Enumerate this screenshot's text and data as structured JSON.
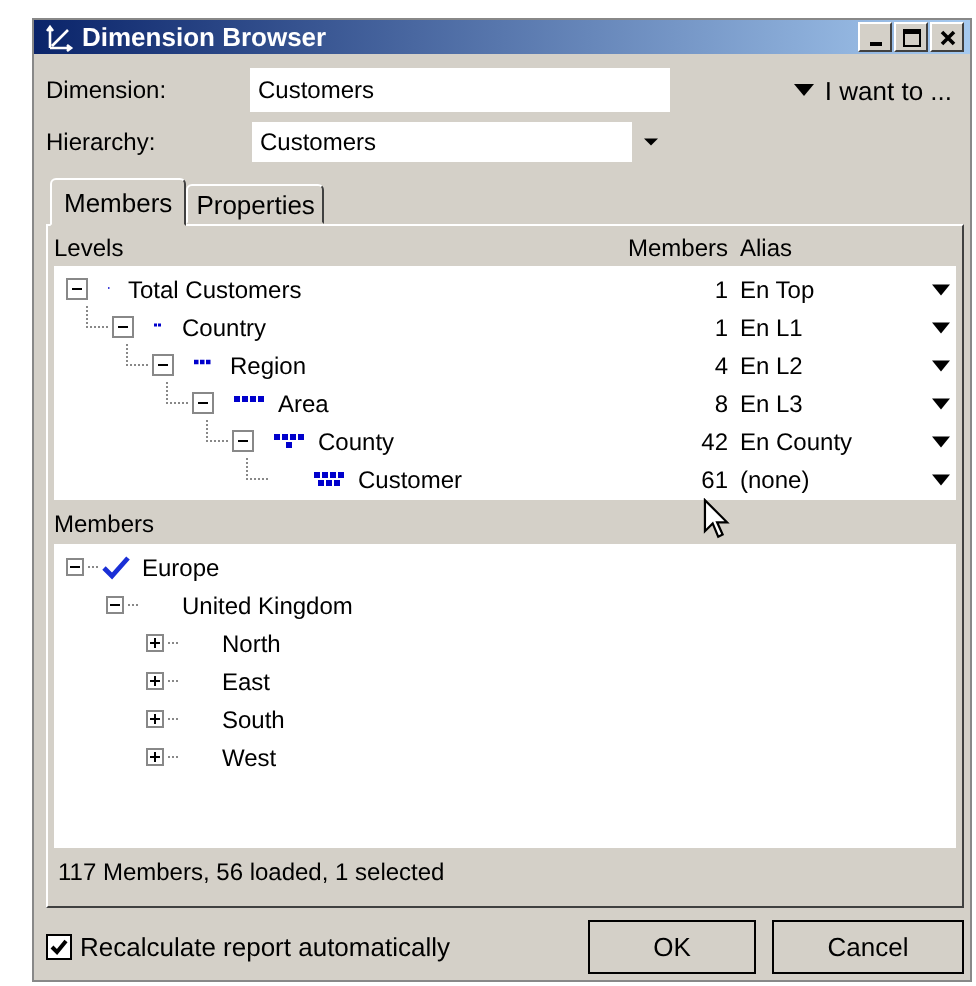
{
  "window": {
    "title": "Dimension Browser"
  },
  "dimension": {
    "label": "Dimension:",
    "value": "Customers"
  },
  "hierarchy": {
    "label": "Hierarchy:",
    "value": "Customers"
  },
  "menu": {
    "label": "I want to ..."
  },
  "tabs": [
    {
      "label": "Members",
      "selected": true
    },
    {
      "label": "Properties",
      "selected": false
    }
  ],
  "levels": {
    "columns": [
      "Levels",
      "Members",
      "Alias"
    ],
    "rows": [
      {
        "name": "Total Customers",
        "members": "1",
        "alias": "En Top",
        "expanded": true,
        "children": [
          {
            "name": "Country",
            "members": "1",
            "alias": "En L1",
            "expanded": true,
            "children": [
              {
                "name": "Region",
                "members": "4",
                "alias": "En L2",
                "expanded": true,
                "children": [
                  {
                    "name": "Area",
                    "members": "8",
                    "alias": "En L3",
                    "expanded": true,
                    "children": [
                      {
                        "name": "County",
                        "members": "42",
                        "alias": "En County",
                        "expanded": true,
                        "children": [
                          {
                            "name": "Customer",
                            "members": "61",
                            "alias": "(none)"
                          }
                        ]
                      }
                    ]
                  }
                ]
              }
            ]
          }
        ]
      }
    ]
  },
  "members": {
    "heading": "Members",
    "tree": [
      {
        "name": "Europe",
        "selected": true,
        "expanded": true,
        "children": [
          {
            "name": "United Kingdom",
            "selected": false,
            "expanded": true,
            "children": [
              {
                "name": "North",
                "selected": false,
                "expanded": false
              },
              {
                "name": "East",
                "selected": false,
                "expanded": false
              },
              {
                "name": "South",
                "selected": false,
                "expanded": false
              },
              {
                "name": "West",
                "selected": false,
                "expanded": false
              }
            ]
          }
        ]
      }
    ],
    "status": "117 Members, 56 loaded, 1 selected"
  },
  "recalculate": {
    "label": "Recalculate report automatically",
    "checked": true
  },
  "buttons": [
    "OK",
    "Cancel"
  ]
}
